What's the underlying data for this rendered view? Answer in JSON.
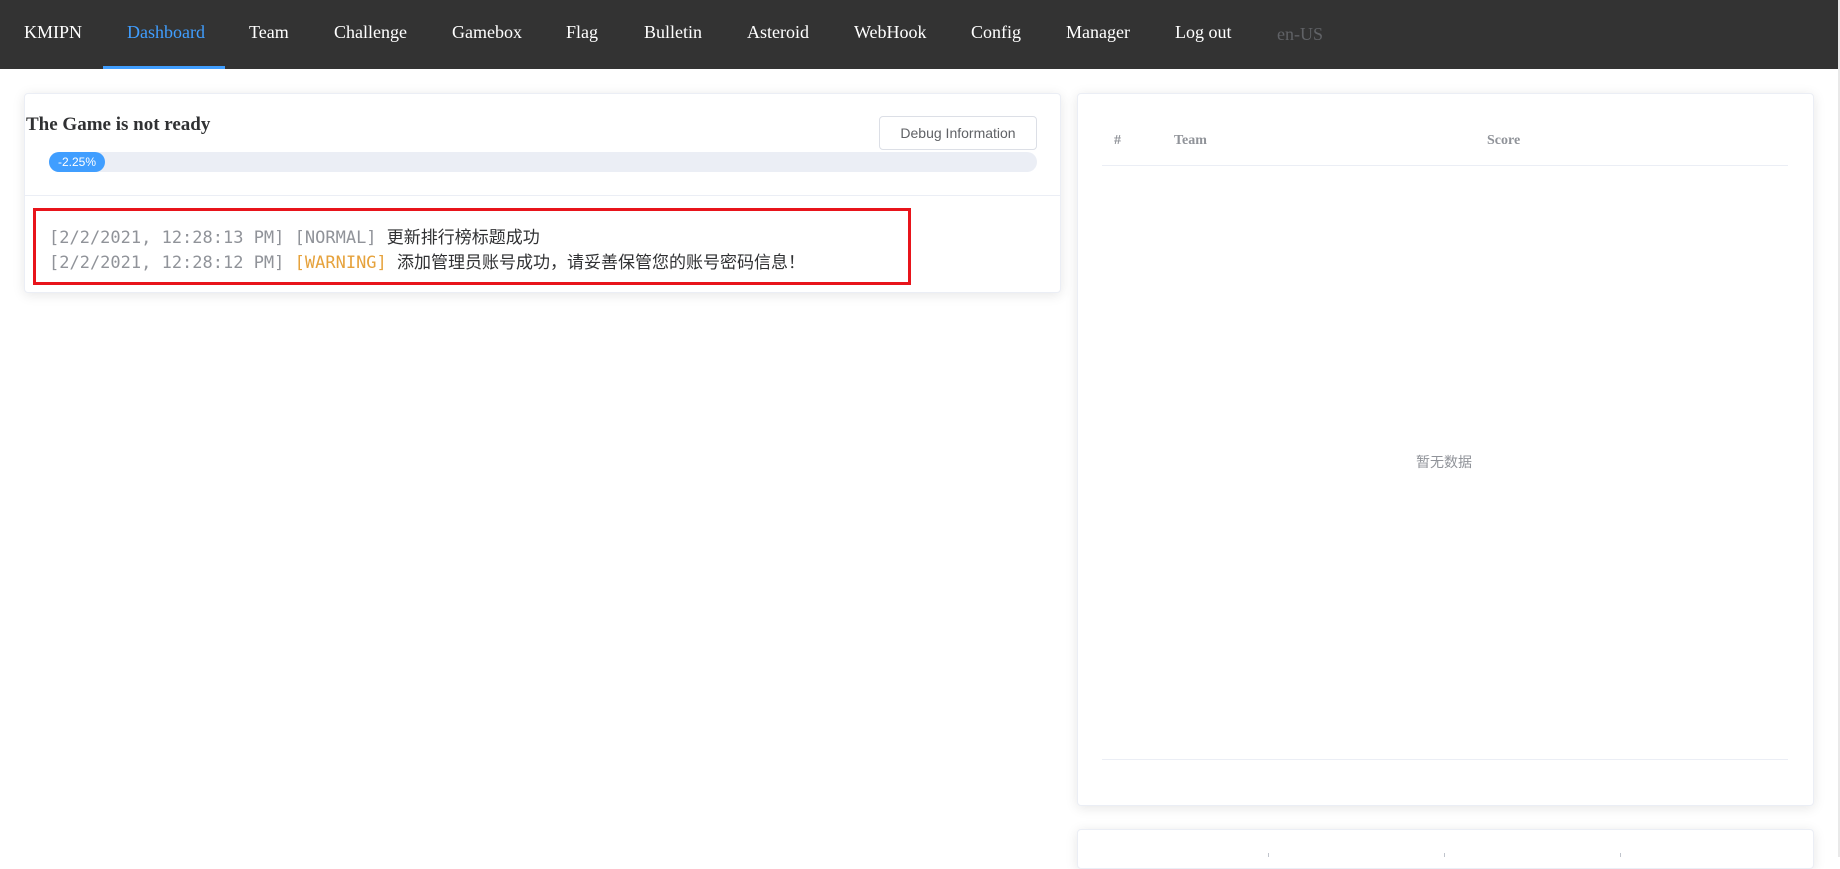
{
  "nav": {
    "brand": "KMIPN",
    "items": [
      {
        "label": "Dashboard",
        "active": true
      },
      {
        "label": "Team"
      },
      {
        "label": "Challenge"
      },
      {
        "label": "Gamebox"
      },
      {
        "label": "Flag"
      },
      {
        "label": "Bulletin"
      },
      {
        "label": "Asteroid"
      },
      {
        "label": "WebHook"
      },
      {
        "label": "Config"
      },
      {
        "label": "Manager"
      },
      {
        "label": "Log out"
      }
    ],
    "locale": "en-US"
  },
  "status": {
    "title": "The Game is not ready",
    "debug_button": "Debug Information",
    "progress_label": "-2.25%",
    "progress_value": -2.25
  },
  "logs": [
    {
      "time": "[2/2/2021, 12:28:13 PM]",
      "level": "[NORMAL]",
      "message": "更新排行榜标题成功"
    },
    {
      "time": "[2/2/2021, 12:28:12 PM]",
      "level": "[WARNING]",
      "message": "添加管理员账号成功，请妥善保管您的账号密码信息！"
    }
  ],
  "ranking": {
    "columns": [
      "#",
      "Team",
      "Score"
    ],
    "rows": [],
    "empty_text": "暂无数据"
  },
  "colors": {
    "nav_bg": "#333333",
    "accent": "#409eff",
    "warning": "#e6a23c",
    "highlight_box": "#e8141b"
  }
}
